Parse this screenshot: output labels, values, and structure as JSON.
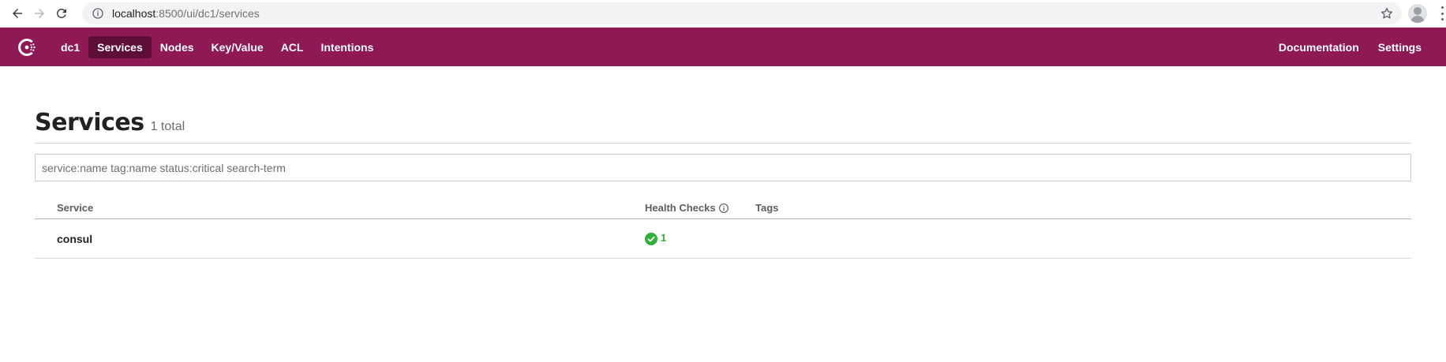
{
  "browser": {
    "url_host": "localhost",
    "url_path": ":8500/ui/dc1/services"
  },
  "header": {
    "datacenter": "dc1",
    "nav": [
      "Services",
      "Nodes",
      "Key/Value",
      "ACL",
      "Intentions"
    ],
    "active": "Services",
    "right_nav": [
      "Documentation",
      "Settings"
    ],
    "brand_color": "#8e1955",
    "active_color": "#5e0f37"
  },
  "page": {
    "title": "Services",
    "count": "1 total"
  },
  "search": {
    "placeholder": "service:name tag:name status:critical search-term",
    "value": ""
  },
  "table": {
    "columns": [
      "Service",
      "Health Checks",
      "Tags"
    ],
    "rows": [
      {
        "service": "consul",
        "health_passing": "1",
        "health_status": "passing",
        "tags": ""
      }
    ]
  },
  "icons": {
    "logo": "consul-logo-icon",
    "health": "check-circle-icon",
    "info": "info-icon"
  }
}
